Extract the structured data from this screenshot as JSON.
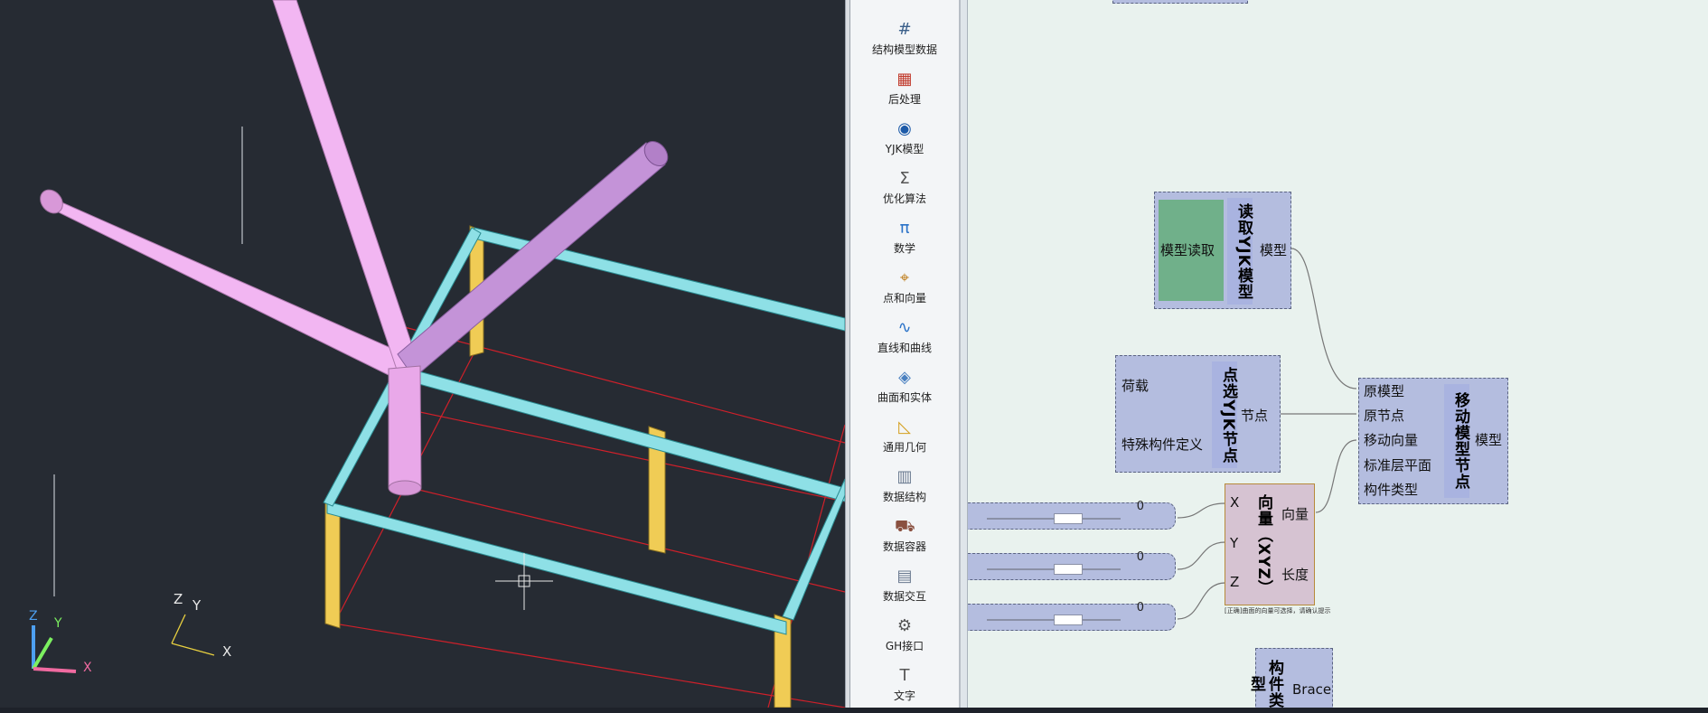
{
  "sidebar": {
    "items": [
      {
        "label": "结构模型数据",
        "icon": "grid-icon",
        "glyph": "#"
      },
      {
        "label": "后处理",
        "icon": "chart-icon",
        "glyph": "▦"
      },
      {
        "label": "YJK模型",
        "icon": "yjk-logo-icon",
        "glyph": "◉"
      },
      {
        "label": "优化算法",
        "icon": "sigma-icon",
        "glyph": "Σ"
      },
      {
        "label": "数学",
        "icon": "pi-icon",
        "glyph": "π"
      },
      {
        "label": "点和向量",
        "icon": "point-vector-icon",
        "glyph": "⌖"
      },
      {
        "label": "直线和曲线",
        "icon": "curve-icon",
        "glyph": "∿"
      },
      {
        "label": "曲面和实体",
        "icon": "surface-icon",
        "glyph": "◈"
      },
      {
        "label": "通用几何",
        "icon": "triangle-ruler-icon",
        "glyph": "◺"
      },
      {
        "label": "数据结构",
        "icon": "data-structure-icon",
        "glyph": "▥"
      },
      {
        "label": "数据容器",
        "icon": "cart-icon",
        "glyph": "⛟"
      },
      {
        "label": "数据交互",
        "icon": "data-exchange-icon",
        "glyph": "▤"
      },
      {
        "label": "GH接口",
        "icon": "gh-interface-icon",
        "glyph": "⚙"
      },
      {
        "label": "文字",
        "icon": "text-icon",
        "glyph": "T"
      }
    ]
  },
  "viewport": {
    "axis_small": {
      "z": "Z",
      "y": "Y",
      "x": "X"
    },
    "axis_large": {
      "z": "Z",
      "y": "Y",
      "x": "X"
    }
  },
  "canvas": {
    "read_model": {
      "title": "读取YJK模型",
      "input": "模型读取",
      "output": "模型"
    },
    "pick_node": {
      "title": "点选YJK节点",
      "inputs": [
        "荷载",
        "特殊构件定义"
      ],
      "output": "节点"
    },
    "move_node": {
      "title": "移动模型节点",
      "inputs": [
        "原模型",
        "原节点",
        "移动向量",
        "标准层平面",
        "构件类型"
      ],
      "output": "模型"
    },
    "vector": {
      "title": "向量（XYZ）",
      "inputs": [
        "X",
        "Y",
        "Z"
      ],
      "outputs": [
        "向量",
        "长度"
      ],
      "note": "[正确]曲面的向量可选择，请确认提示"
    },
    "sliders": [
      {
        "value": "0"
      },
      {
        "value": "0"
      },
      {
        "value": "0"
      }
    ],
    "member_type": {
      "title": "构件类型",
      "output": "Brace"
    }
  },
  "colors": {
    "viewport_bg": "#262b33",
    "beam": "#8ee0e6",
    "column": "#f0cc55",
    "brace": "#eeb0ee",
    "grid_line": "#d0202a",
    "component": "#b4bddf"
  }
}
